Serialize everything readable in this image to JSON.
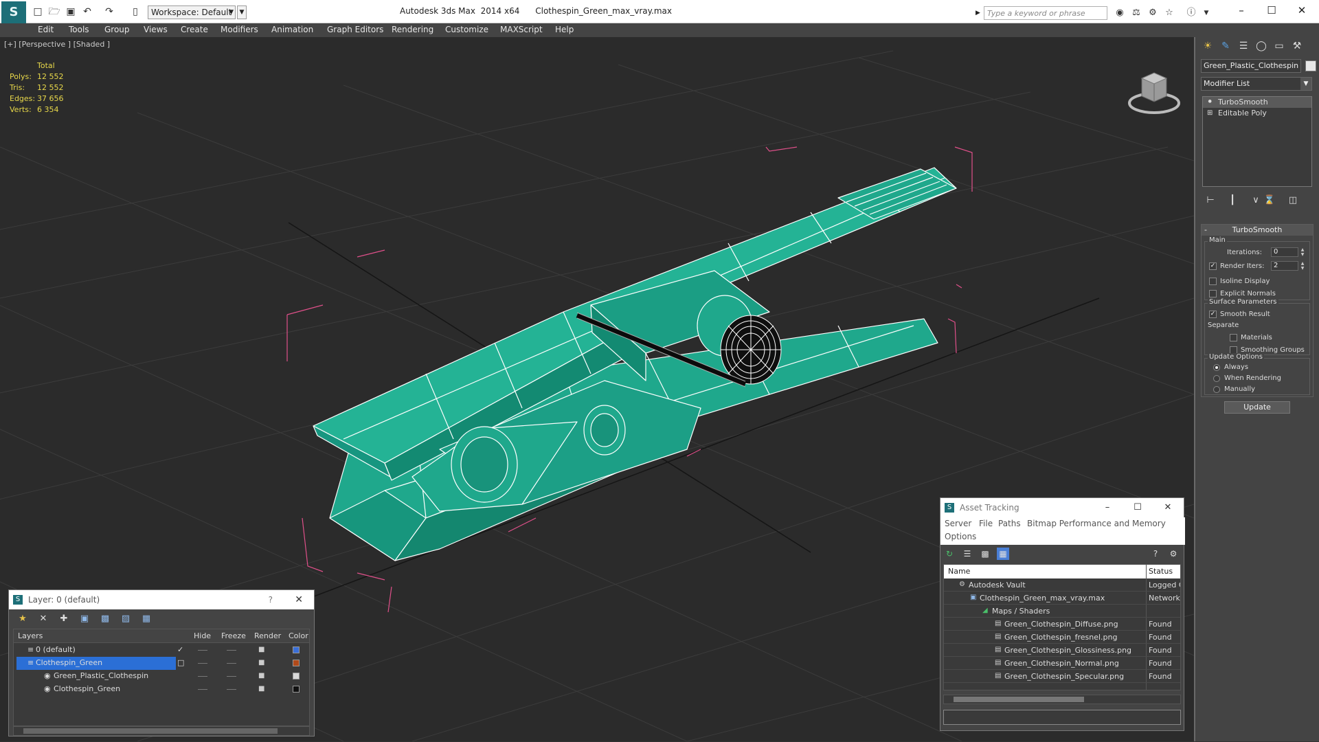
{
  "titlebar": {
    "workspace": "Workspace: Default",
    "app_title": "Autodesk 3ds Max  2014 x64      Clothespin_Green_max_vray.max",
    "search_placeholder": "Type a keyword or phrase"
  },
  "menubar": [
    "Edit",
    "Tools",
    "Group",
    "Views",
    "Create",
    "Modifiers",
    "Animation",
    "Graph Editors",
    "Rendering",
    "Customize",
    "MAXScript",
    "Help"
  ],
  "viewport": {
    "label": "[+] [Perspective ] [Shaded ]",
    "stats": {
      "header": "Total",
      "rows": [
        {
          "label": "Polys:",
          "value": "12 552"
        },
        {
          "label": "Tris:",
          "value": "12 552"
        },
        {
          "label": "Edges:",
          "value": "37 656"
        },
        {
          "label": "Verts:",
          "value": "6 354"
        }
      ]
    },
    "model_color": "#1fa88c",
    "wire_color": "#ffffff",
    "bbox_color": "#e0508a"
  },
  "command_panel": {
    "object_name": "Green_Plastic_Clothespin",
    "modifier_list": "Modifier List",
    "stack": [
      "TurboSmooth",
      "Editable Poly"
    ],
    "rollout_title": "TurboSmooth",
    "main_group": "Main",
    "iterations_label": "Iterations:",
    "iterations_value": "0",
    "render_iters_label": "Render Iters:",
    "render_iters_value": "2",
    "isoline": "Isoline Display",
    "explicit_normals": "Explicit Normals",
    "surface_group": "Surface Parameters",
    "smooth_result": "Smooth Result",
    "separate": "Separate",
    "materials": "Materials",
    "smoothing_groups": "Smoothing Groups",
    "update_group": "Update Options",
    "always": "Always",
    "when_rendering": "When Rendering",
    "manually": "Manually",
    "update_button": "Update"
  },
  "layer_panel": {
    "title": "Layer: 0 (default)",
    "help": "?",
    "columns": [
      "Layers",
      "Hide",
      "Freeze",
      "Render",
      "Color"
    ],
    "rows": [
      {
        "name": "0 (default)",
        "color": "#3a6fd8"
      },
      {
        "name": "Clothespin_Green",
        "color": "#b04a1a"
      },
      {
        "name": "Green_Plastic_Clothespin",
        "color": "#d8d8d8"
      },
      {
        "name": "Clothespin_Green",
        "color": "#111111"
      }
    ]
  },
  "asset_tracking": {
    "title": "Asset Tracking",
    "menu": [
      "Server",
      "File",
      "Paths",
      "Bitmap Performance and Memory",
      "Options"
    ],
    "columns": [
      "Name",
      "Status"
    ],
    "rows": [
      {
        "name": "Autodesk Vault",
        "status": "Logged Out"
      },
      {
        "name": "Clothespin_Green_max_vray.max",
        "status": "Network"
      },
      {
        "name": "Maps / Shaders",
        "status": ""
      },
      {
        "name": "Green_Clothespin_Diffuse.png",
        "status": "Found"
      },
      {
        "name": "Green_Clothespin_fresnel.png",
        "status": "Found"
      },
      {
        "name": "Green_Clothespin_Glossiness.png",
        "status": "Found"
      },
      {
        "name": "Green_Clothespin_Normal.png",
        "status": "Found"
      },
      {
        "name": "Green_Clothespin_Specular.png",
        "status": "Found"
      }
    ]
  }
}
